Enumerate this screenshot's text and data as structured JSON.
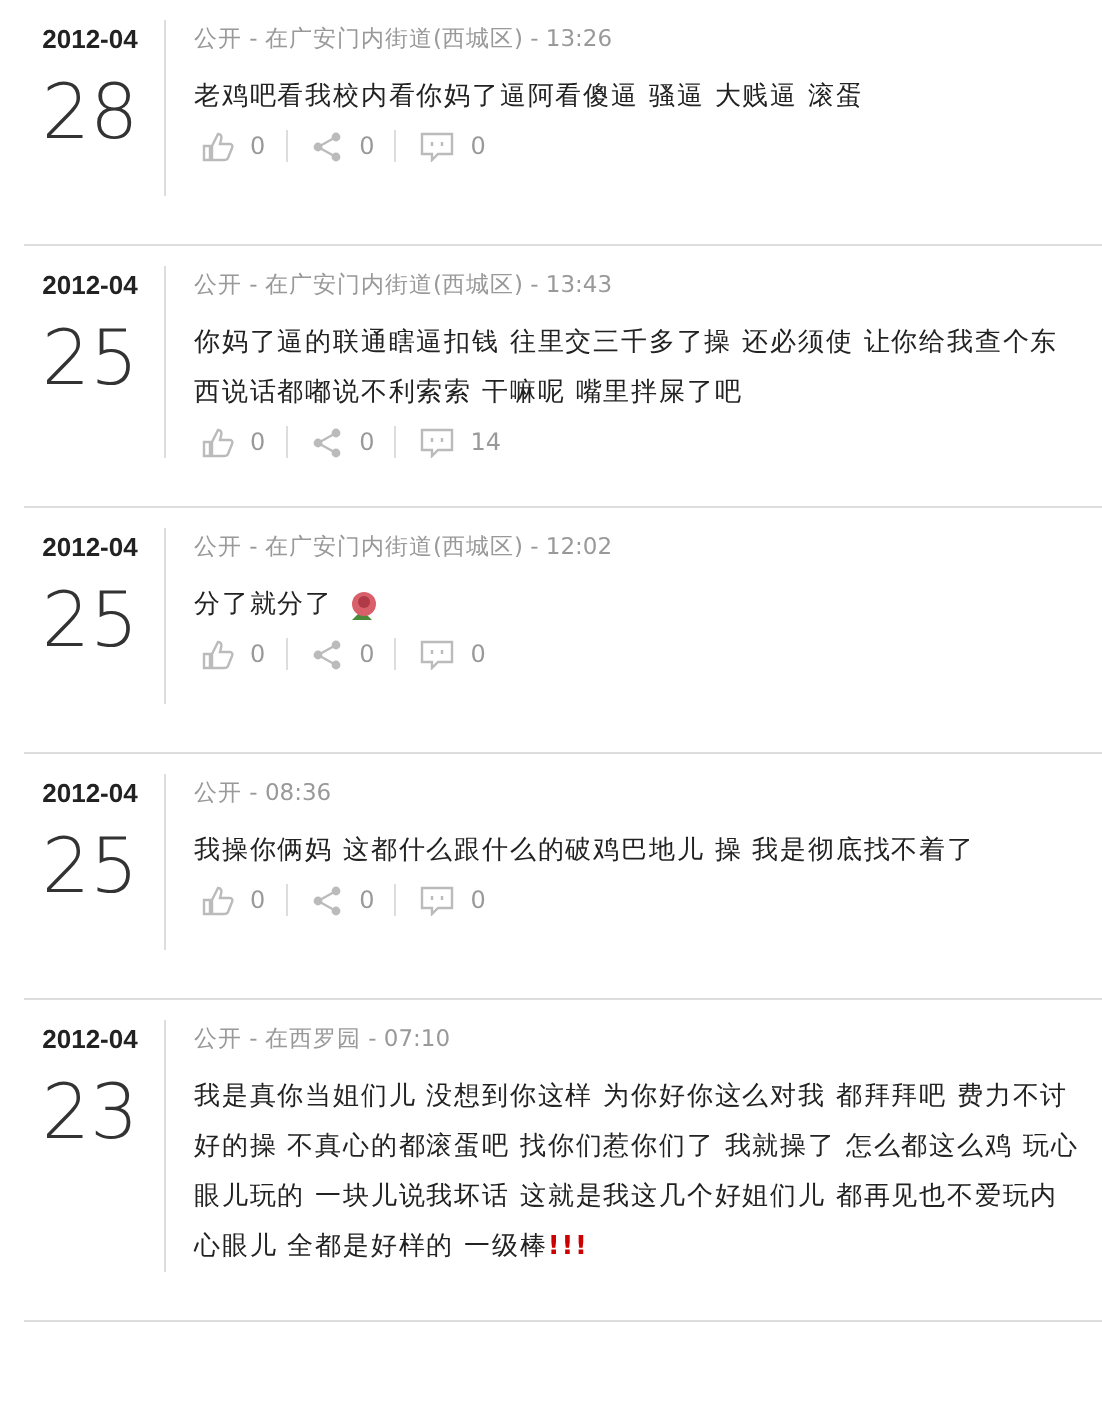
{
  "posts": [
    {
      "year_month": "2012-04",
      "day": "28",
      "meta": "公开 - 在广安门内街道(西城区) - 13:26",
      "text": "老鸡吧看我校内看你妈了逼阿看傻逼 骚逼 大贱逼 滚蛋",
      "likes": "0",
      "shares": "0",
      "comments": "0"
    },
    {
      "year_month": "2012-04",
      "day": "25",
      "meta": "公开 - 在广安门内街道(西城区) - 13:43",
      "text": "你妈了逼的联通瞎逼扣钱 往里交三千多了操 还必须使 让你给我查个东西说话都嘟说不利索索 干嘛呢 嘴里拌屎了吧",
      "likes": "0",
      "shares": "0",
      "comments": "14"
    },
    {
      "year_month": "2012-04",
      "day": "25",
      "meta": "公开 - 在广安门内街道(西城区) - 12:02",
      "text": "分了就分了",
      "has_emoji": true,
      "likes": "0",
      "shares": "0",
      "comments": "0"
    },
    {
      "year_month": "2012-04",
      "day": "25",
      "meta": "公开 - 08:36",
      "text": "我操你俩妈 这都什么跟什么的破鸡巴地儿 操 我是彻底找不着了",
      "likes": "0",
      "shares": "0",
      "comments": "0"
    },
    {
      "year_month": "2012-04",
      "day": "23",
      "meta": "公开 - 在西罗园 - 07:10",
      "text": "我是真你当姐们儿 没想到你这样 为你好你这么对我 都拜拜吧 费力不讨好的操 不真心的都滚蛋吧 找你们惹你们了 我就操了 怎么都这么鸡 玩心眼儿玩的 一块儿说我坏话 这就是我这几个好姐们儿 都再见也不爱玩内心眼儿 全都是好样的 一级棒",
      "emphasis": "!!!"
    }
  ]
}
